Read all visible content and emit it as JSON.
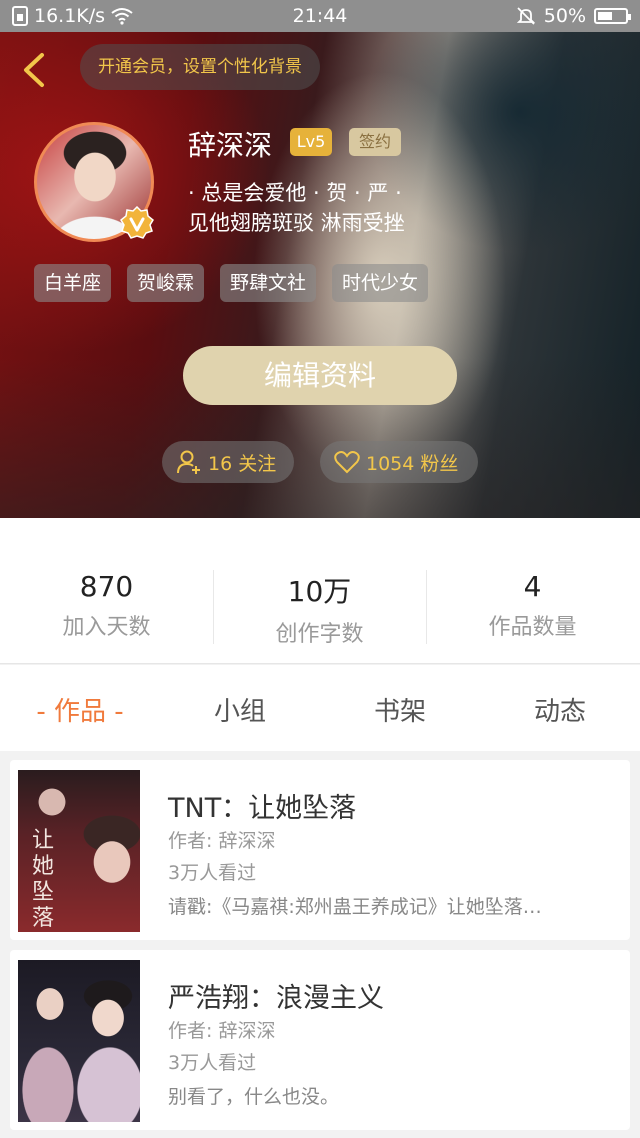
{
  "status_bar": {
    "network_speed": "16.1K/s",
    "time": "21:44",
    "battery_percent": "50%",
    "battery_level": 0.5
  },
  "header": {
    "member_banner": "开通会员，设置个性化背景",
    "username": "辞深深",
    "level_badge": "Lv5",
    "sign_badge": "签约",
    "bio_line1": "· 总是会爱他 · 贺 · 严 ·",
    "bio_line2": "见他翅膀斑驳 淋雨受挫",
    "tags": [
      "白羊座",
      "贺峻霖",
      "野肆文社",
      "时代少女"
    ],
    "edit_button": "编辑资料",
    "following": "16 关注",
    "fans": "1054 粉丝"
  },
  "stats": [
    {
      "value": "870",
      "label": "加入天数"
    },
    {
      "value": "10万",
      "label": "创作字数"
    },
    {
      "value": "4",
      "label": "作品数量"
    }
  ],
  "tabs": [
    "- 作品 -",
    "小组",
    "书架",
    "动态"
  ],
  "works": [
    {
      "title": "TNT：让她坠落",
      "author": "作者: 辞深深",
      "views": "3万人看过",
      "desc": "请戳:《马嘉祺:郑州蛊王养成记》让她坠落…",
      "cover_text": "让她坠落"
    },
    {
      "title": "严浩翔：浪漫主义",
      "author": "作者: 辞深深",
      "views": "3万人看过",
      "desc": "别看了，什么也没。"
    }
  ],
  "colors": {
    "accent": "#f07a3c",
    "gold": "#f2c64a",
    "edit_button": "#e0d3ae"
  }
}
